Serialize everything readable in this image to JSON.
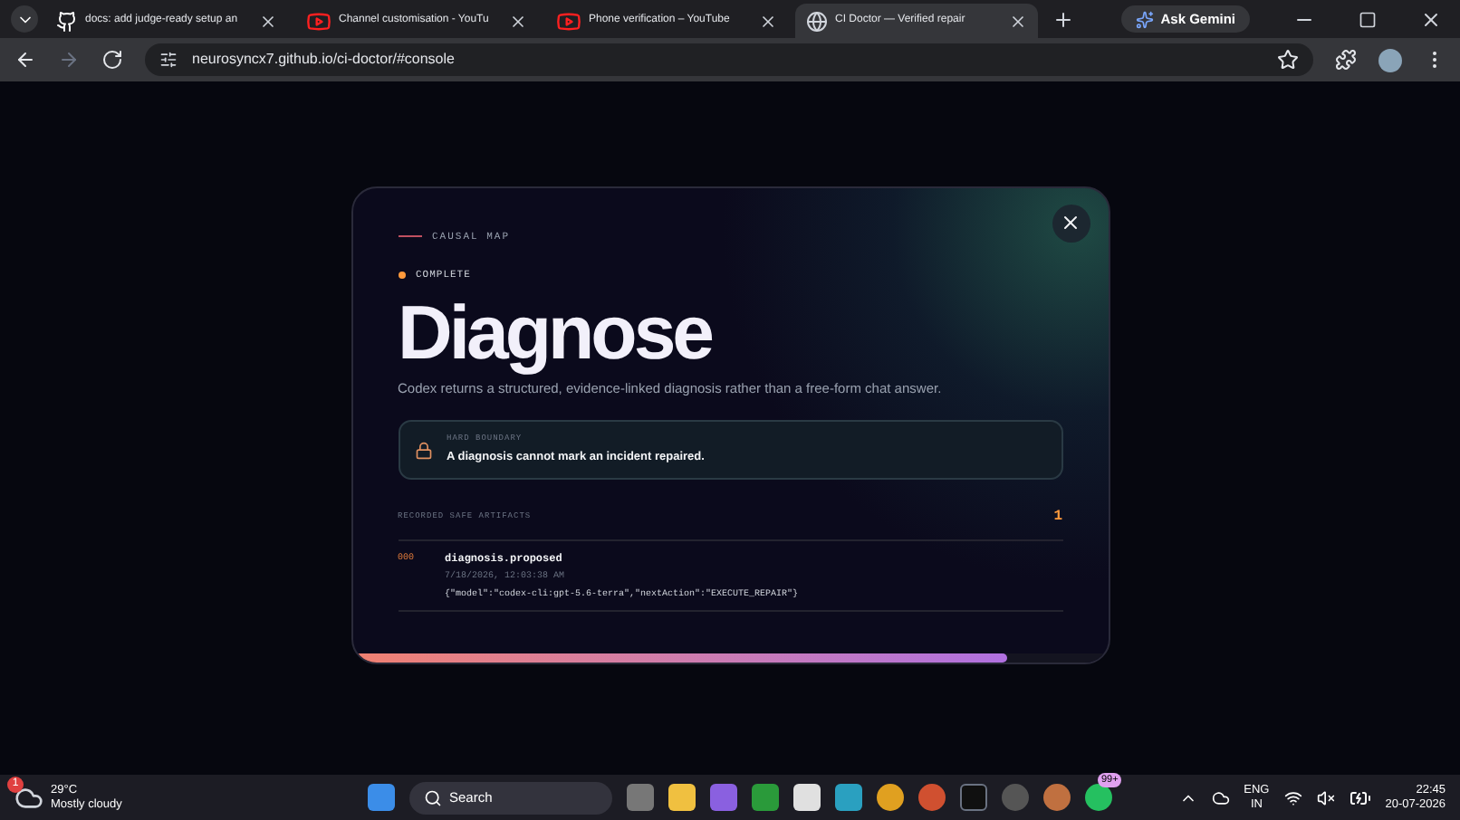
{
  "browser": {
    "tabs": [
      {
        "kind": "github",
        "title": "docs: add judge-ready setup an",
        "selected": false
      },
      {
        "kind": "youtube",
        "title": "Channel customisation - YouTu",
        "selected": false
      },
      {
        "kind": "youtube",
        "title": "Phone verification – YouTube",
        "selected": false
      },
      {
        "kind": "globe",
        "title": "CI Doctor — Verified repair",
        "selected": true
      }
    ],
    "ask_gemini": "Ask Gemini",
    "url": "neurosyncx7.github.io/ci-doctor/#console"
  },
  "modal": {
    "eyebrow": "CAUSAL MAP",
    "status": "COMPLETE",
    "title": "Diagnose",
    "description": "Codex returns a structured, evidence-linked diagnosis rather than a free-form chat answer.",
    "boundary": {
      "label": "HARD BOUNDARY",
      "text": "A diagnosis cannot mark an incident repaired."
    },
    "artifacts": {
      "heading": "RECORDED SAFE ARTIFACTS",
      "count": "1",
      "items": [
        {
          "index": "000",
          "name": "diagnosis.proposed",
          "time": "7/18/2026, 12:03:38 AM",
          "payload": "{\"model\":\"codex-cli:gpt-5.6-terra\",\"nextAction\":\"EXECUTE_REPAIR\"}"
        }
      ]
    },
    "progress": {
      "level": 0.866
    }
  },
  "taskbar": {
    "weather": {
      "badge": "1",
      "temp": "29°C",
      "condition": "Mostly cloudy"
    },
    "search": "Search",
    "whatsapp_badge": "99+",
    "language": "ENG",
    "region": "IN",
    "time": "22:45",
    "date": "20-07-2026"
  }
}
